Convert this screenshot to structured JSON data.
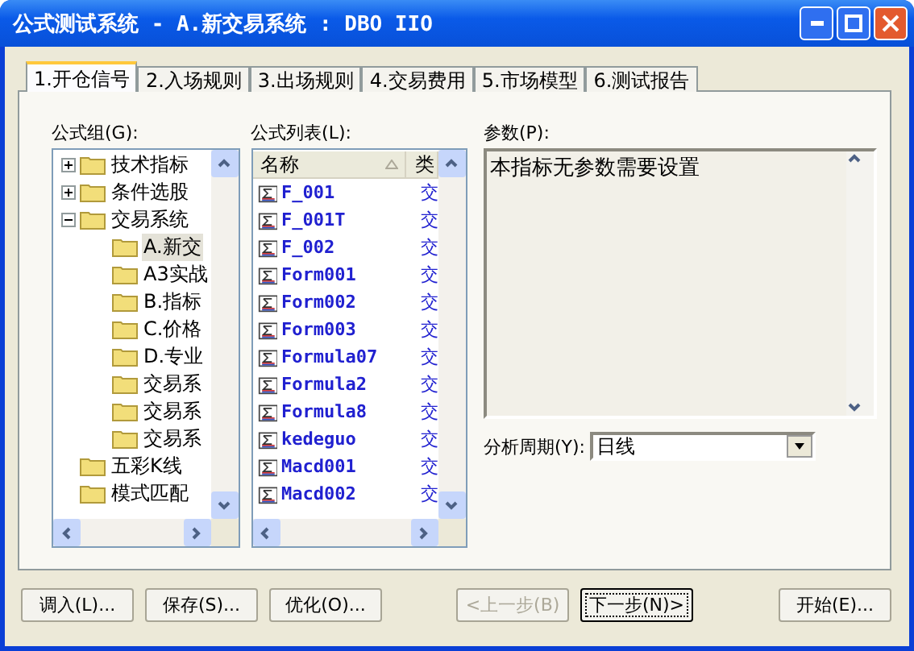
{
  "window": {
    "title": "公式测试系统 - A.新交易系统 : DBO IIO"
  },
  "tabs": [
    {
      "label": "1.开仓信号",
      "selected": true
    },
    {
      "label": "2.入场规则",
      "selected": false
    },
    {
      "label": "3.出场规则",
      "selected": false
    },
    {
      "label": "4.交易费用",
      "selected": false
    },
    {
      "label": "5.市场模型",
      "selected": false
    },
    {
      "label": "6.测试报告",
      "selected": false
    }
  ],
  "formula_group": {
    "label": "公式组(G):",
    "tree": [
      {
        "label": "技术指标",
        "expanded": false,
        "selected": false
      },
      {
        "label": "条件选股",
        "expanded": false,
        "selected": false
      },
      {
        "label": "交易系统",
        "expanded": true,
        "selected": false,
        "children": [
          {
            "label": "A.新交",
            "selected": true
          },
          {
            "label": "A3实战",
            "selected": false
          },
          {
            "label": "B.指标",
            "selected": false
          },
          {
            "label": "C.价格",
            "selected": false
          },
          {
            "label": "D.专业",
            "selected": false
          },
          {
            "label": "交易系",
            "selected": false
          },
          {
            "label": "交易系",
            "selected": false
          },
          {
            "label": "交易系",
            "selected": false
          }
        ]
      },
      {
        "label": "五彩K线",
        "selected": false
      },
      {
        "label": "模式匹配",
        "selected": false
      }
    ]
  },
  "formula_list": {
    "label": "公式列表(L):",
    "columns": [
      "名称",
      "类"
    ],
    "rows": [
      {
        "name": "F_001",
        "column_2": "交"
      },
      {
        "name": "F_001T",
        "column_2": "交"
      },
      {
        "name": "F_002",
        "column_2": "交"
      },
      {
        "name": "Form001",
        "column_2": "交"
      },
      {
        "name": "Form002",
        "column_2": "交"
      },
      {
        "name": "Form003",
        "column_2": "交"
      },
      {
        "name": "Formula07",
        "column_2": "交"
      },
      {
        "name": "Formula2",
        "column_2": "交"
      },
      {
        "name": "Formula8",
        "column_2": "交"
      },
      {
        "name": "kedeguo",
        "column_2": "交"
      },
      {
        "name": "Macd001",
        "column_2": "交"
      },
      {
        "name": "Macd002",
        "column_2": "交"
      }
    ]
  },
  "parameters": {
    "label": "参数(P):",
    "text": "本指标无参数需要设置"
  },
  "period": {
    "label": "分析周期(Y):",
    "value": "日线"
  },
  "buttons": [
    {
      "label": "调入(L)...",
      "disabled": false,
      "focused": false
    },
    {
      "label": "保存(S)...",
      "disabled": false,
      "focused": false
    },
    {
      "label": "优化(O)...",
      "disabled": false,
      "focused": false
    },
    {
      "label": "<上一步(B)",
      "disabled": true,
      "focused": false
    },
    {
      "label": "下一步(N)>",
      "disabled": false,
      "focused": true
    },
    {
      "label": "开始(E)...",
      "disabled": false,
      "focused": false
    }
  ]
}
